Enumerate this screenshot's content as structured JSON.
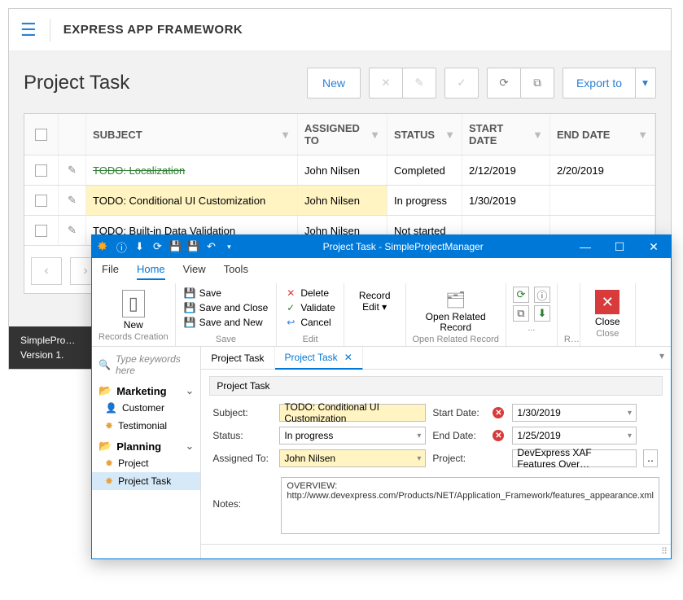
{
  "web": {
    "title": "EXPRESS APP FRAMEWORK",
    "pageTitle": "Project Task",
    "newBtn": "New",
    "exportBtn": "Export to",
    "cols": {
      "subject": "SUBJECT",
      "assigned": "ASSIGNED TO",
      "status": "STATUS",
      "start": "START DATE",
      "end": "END DATE"
    },
    "rows": [
      {
        "subject": "TODO: Localization",
        "assigned": "John Nilsen",
        "status": "Completed",
        "start": "2/12/2019",
        "end": "2/20/2019",
        "done": true
      },
      {
        "subject": "TODO: Conditional UI Customization",
        "assigned": "John Nilsen",
        "status": "In progress",
        "start": "1/30/2019",
        "end": "",
        "hl": true
      },
      {
        "subject": "TODO: Built-in Data Validation",
        "assigned": "John Nilsen",
        "status": "Not started",
        "start": "",
        "end": ""
      }
    ],
    "footer": {
      "l1": "SimplePro…",
      "l2": "Version 1."
    }
  },
  "win": {
    "title": "Project Task - SimpleProjectManager",
    "menus": [
      "File",
      "Home",
      "View",
      "Tools"
    ],
    "ribbon": {
      "new": "New",
      "recordsCreation": "Records Creation",
      "save": "Save",
      "saveClose": "Save and Close",
      "saveNew": "Save and New",
      "saveGroup": "Save",
      "delete": "Delete",
      "validate": "Validate",
      "cancel": "Cancel",
      "editGroup": "Edit",
      "recordEdit": "Record\nEdit ▾",
      "openRelated": "Open Related\nRecord",
      "openRelatedGroup": "Open Related Record",
      "dots": "...",
      "r": "R…",
      "close": "Close",
      "closeGroup": "Close"
    },
    "searchPlaceholder": "Type keywords here",
    "groups": {
      "marketing": "Marketing",
      "customer": "Customer",
      "testimonial": "Testimonial",
      "planning": "Planning",
      "project": "Project",
      "projectTask": "Project Task"
    },
    "tabs": [
      "Project Task",
      "Project Task"
    ],
    "panelTitle": "Project Task",
    "form": {
      "subjectL": "Subject:",
      "subjectV": "TODO: Conditional UI Customization",
      "statusL": "Status:",
      "statusV": "In progress",
      "assignedL": "Assigned To:",
      "assignedV": "John Nilsen",
      "startL": "Start Date:",
      "startV": "1/30/2019",
      "endL": "End Date:",
      "endV": "1/25/2019",
      "projectL": "Project:",
      "projectV": "DevExpress XAF Features Over…",
      "notesL": "Notes:",
      "notesV": "OVERVIEW:\nhttp://www.devexpress.com/Products/NET/Application_Framework/features_appearance.xml"
    }
  }
}
